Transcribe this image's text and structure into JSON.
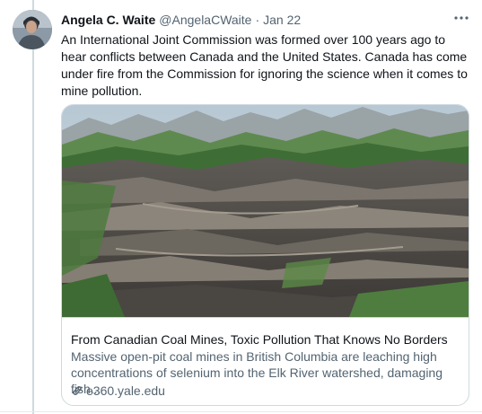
{
  "tweet": {
    "author_name": "Angela C. Waite",
    "handle": "@AngelaCWaite",
    "separator": "·",
    "date": "Jan 22",
    "more_icon": "more-horizontal-icon",
    "text": "An International Joint Commission was formed over 100 years ago to hear conflicts between Canada and the United States. Canada has come under fire from the Commission for ignoring the science when it comes to mine pollution."
  },
  "card": {
    "title": "From Canadian Coal Mines, Toxic Pollution That Knows No Borders",
    "description": "Massive open-pit coal mines in British Columbia are leaching high concentrations of selenium into the Elk River watershed, damaging fish...",
    "domain": "e360.yale.edu",
    "link_icon": "link-icon"
  },
  "colors": {
    "text_primary": "#0f1419",
    "text_secondary": "#536471",
    "border": "#cfd9de",
    "thread_line": "#cfd9de"
  }
}
